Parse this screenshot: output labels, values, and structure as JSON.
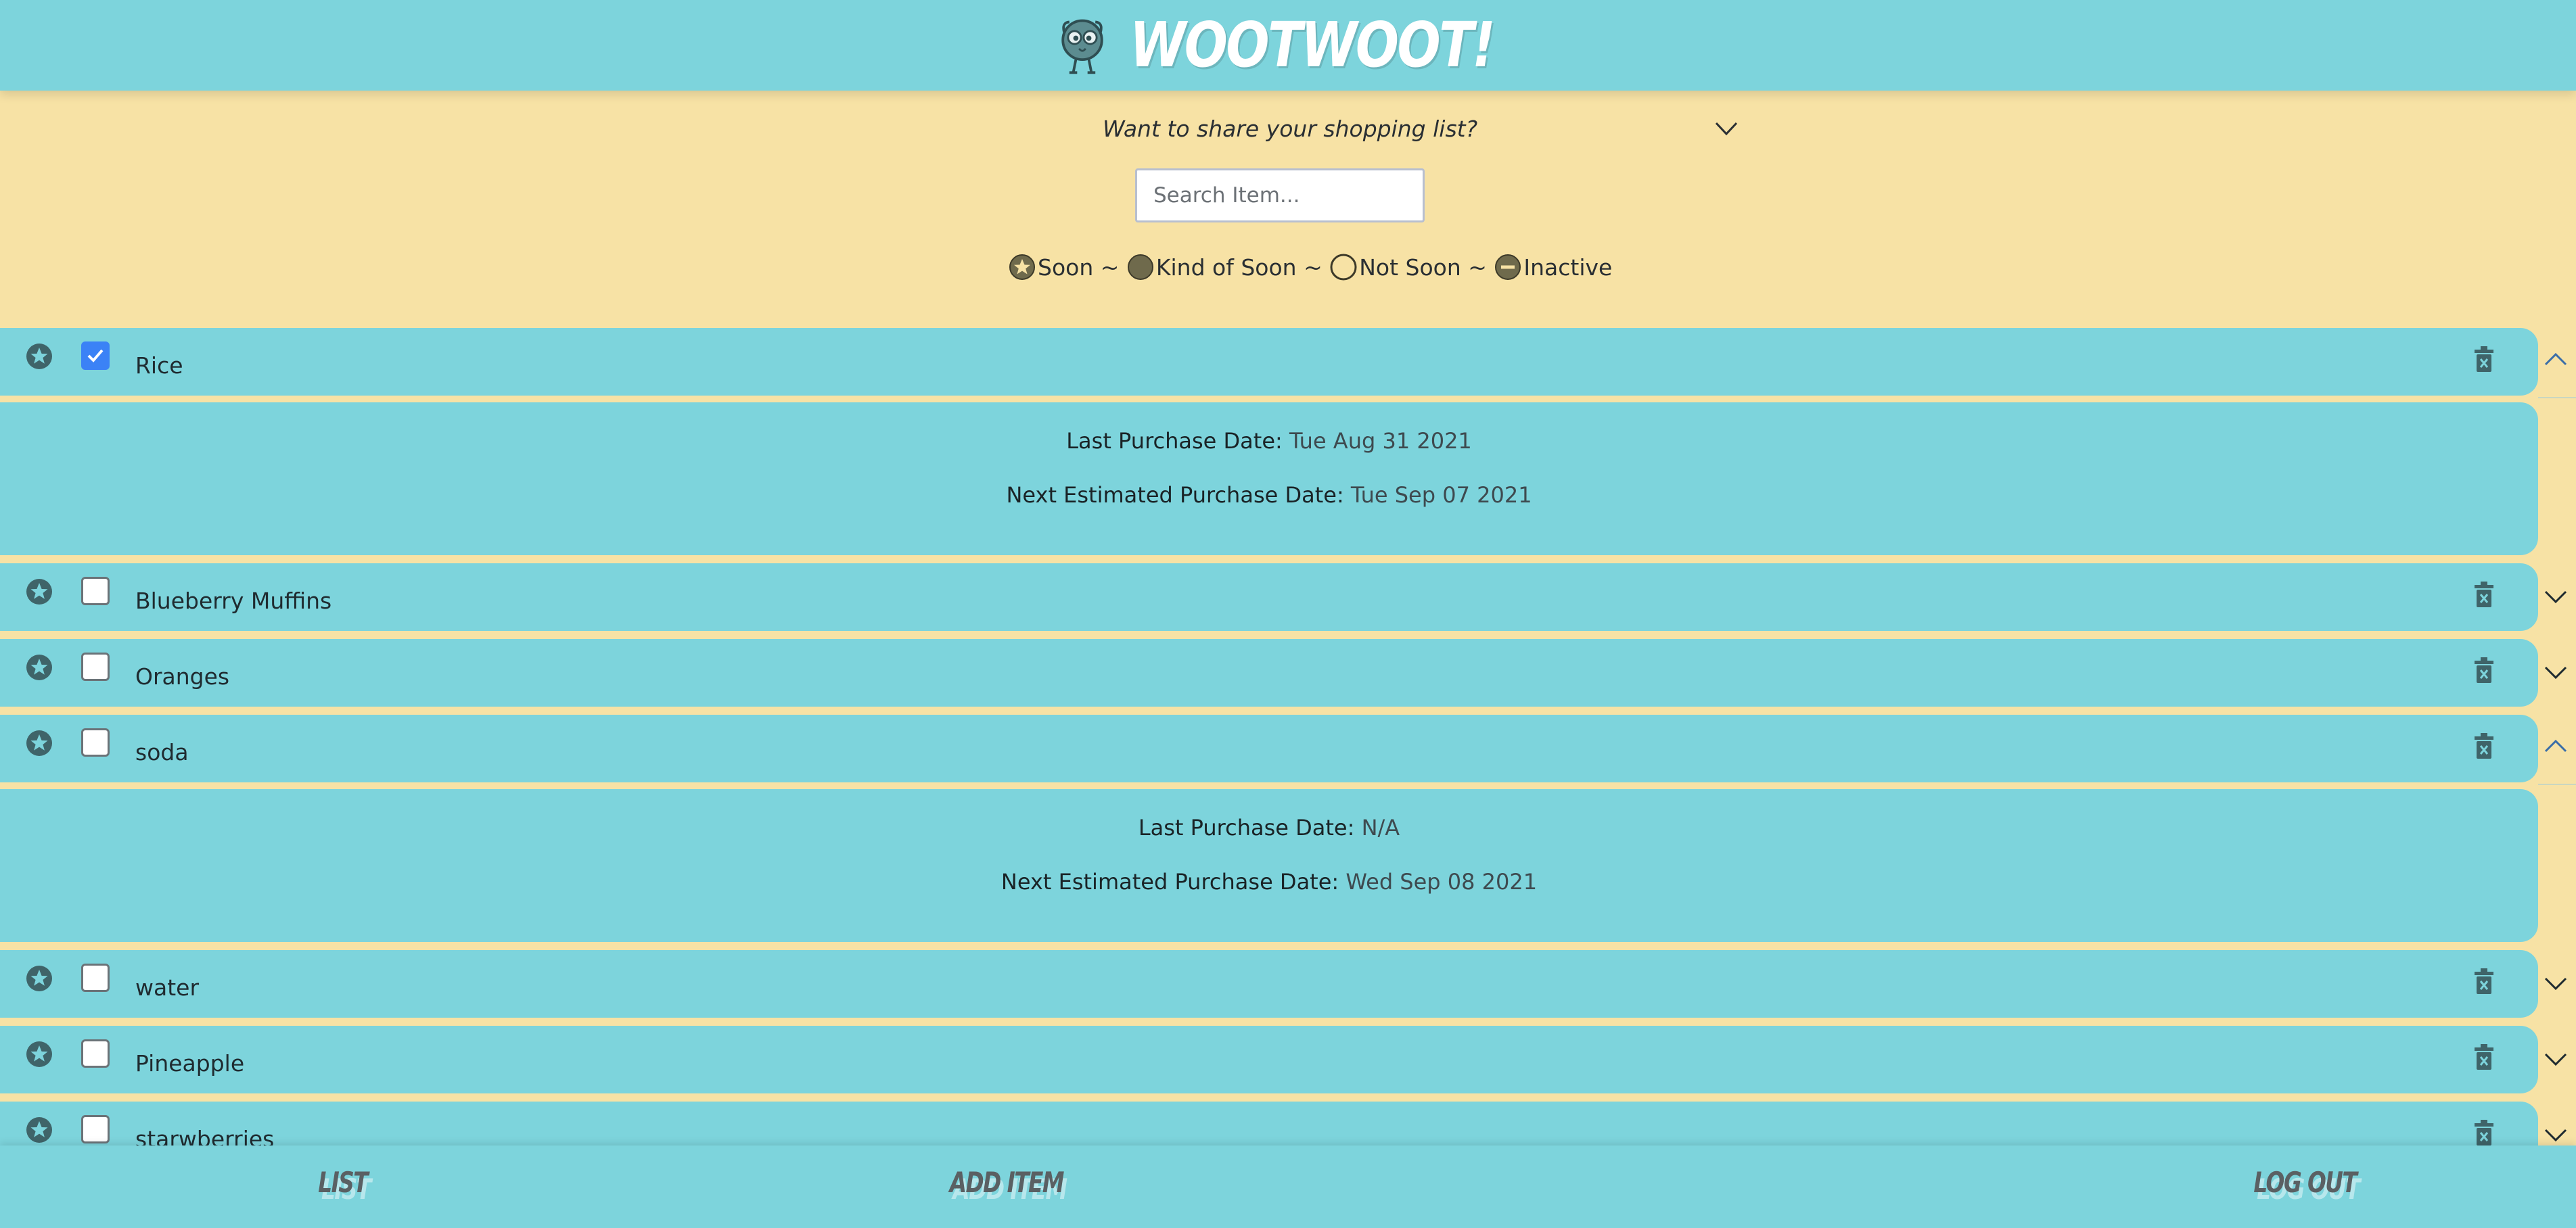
{
  "app": {
    "title": "WOOTWOOT!"
  },
  "share": {
    "prompt": "Want to share your shopping list?"
  },
  "search": {
    "placeholder": "Search Item..."
  },
  "legend": [
    {
      "icon": "star-circle-icon",
      "label": "Soon ~ "
    },
    {
      "icon": "filled-circle-icon",
      "label": "Kind of Soon ~ "
    },
    {
      "icon": "empty-circle-icon",
      "label": "Not Soon ~ "
    },
    {
      "icon": "minus-circle-icon",
      "label": "Inactive"
    }
  ],
  "details_labels": {
    "last": "Last Purchase Date:",
    "next": "Next Estimated Purchase Date:"
  },
  "items": [
    {
      "name": "Rice",
      "checked": true,
      "expanded": true,
      "last_purchase": "Tue Aug 31 2021",
      "next_purchase": "Tue Sep 07 2021"
    },
    {
      "name": "Blueberry Muffins",
      "checked": false,
      "expanded": false
    },
    {
      "name": "Oranges",
      "checked": false,
      "expanded": false
    },
    {
      "name": "soda",
      "checked": false,
      "expanded": true,
      "last_purchase": "N/A",
      "next_purchase": "Wed Sep 08 2021"
    },
    {
      "name": "water",
      "checked": false,
      "expanded": false
    },
    {
      "name": "Pineapple",
      "checked": false,
      "expanded": false
    },
    {
      "name": "starwberries",
      "checked": false,
      "expanded": false
    }
  ],
  "nav": {
    "list": "LIST",
    "add_item": "ADD ITEM",
    "log_out": "LOG OUT"
  },
  "colors": {
    "header": "#7dd4dc",
    "background": "#f7e2a5",
    "icon": "#3f6469",
    "checked": "#3b82f6"
  }
}
